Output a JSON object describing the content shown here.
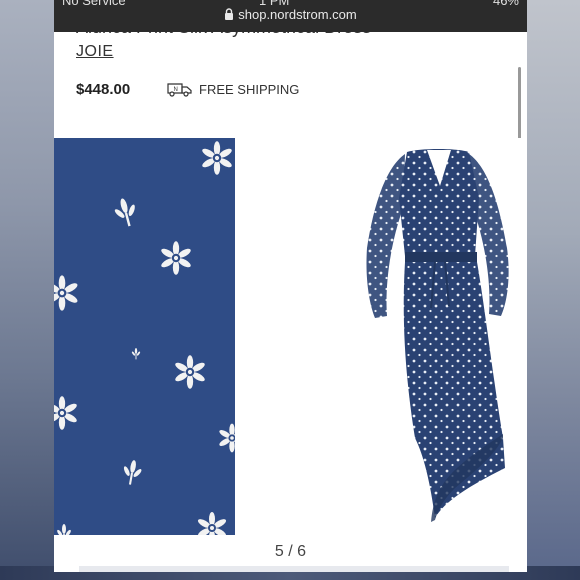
{
  "status_bar": {
    "carrier": "No Service",
    "time": "1 PM",
    "battery": "46%"
  },
  "browser": {
    "url": "shop.nordstrom.com"
  },
  "product": {
    "name": "Alunca Print Silk Asymmetrical Dress",
    "brand": "JOIE",
    "price": "$448.00",
    "shipping": "FREE SHIPPING"
  },
  "gallery": {
    "pager": "5 / 6"
  },
  "colors": {
    "swatch_navy": "#2f4c86",
    "dress_navy": "#2a4273",
    "flower_white": "#f2f2f2"
  },
  "icons": {
    "lock": "lock-icon",
    "shipping": "delivery-truck-icon"
  }
}
